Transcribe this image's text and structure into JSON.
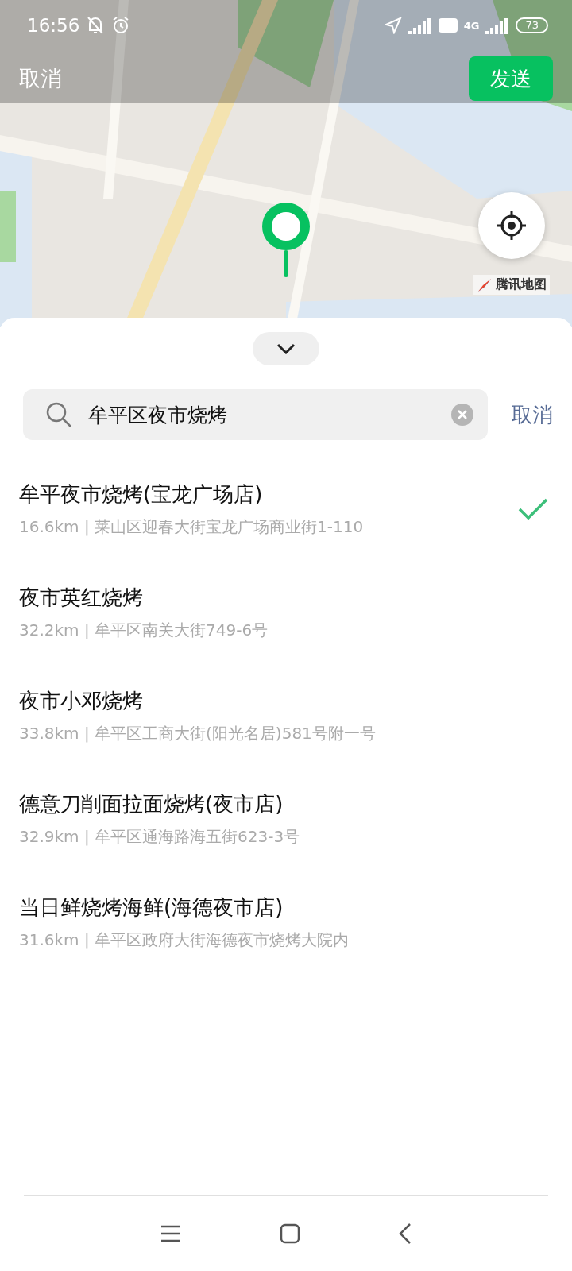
{
  "status_bar": {
    "time": "16:56",
    "battery": "73",
    "network": "4G"
  },
  "header": {
    "cancel": "取消",
    "send": "发送"
  },
  "map": {
    "kind": "picture",
    "attribution": "腾讯地图"
  },
  "search": {
    "value": "牟平区夜市烧烤",
    "cancel": "取消"
  },
  "results": [
    {
      "name": "牟平夜市烧烤(宝龙广场店)",
      "detail": "16.6km | 莱山区迎春大街宝龙广场商业街1-110",
      "selected": true
    },
    {
      "name": "夜市英红烧烤",
      "detail": "32.2km | 牟平区南关大街749-6号",
      "selected": false
    },
    {
      "name": "夜市小邓烧烤",
      "detail": "33.8km | 牟平区工商大街(阳光名居)581号附一号",
      "selected": false
    },
    {
      "name": "德意刀削面拉面烧烤(夜市店)",
      "detail": "32.9km | 牟平区通海路海五街623-3号",
      "selected": false
    },
    {
      "name": "当日鲜烧烤海鲜(海德夜市店)",
      "detail": "31.6km | 牟平区政府大街海德夜市烧烤大院内",
      "selected": false
    }
  ]
}
